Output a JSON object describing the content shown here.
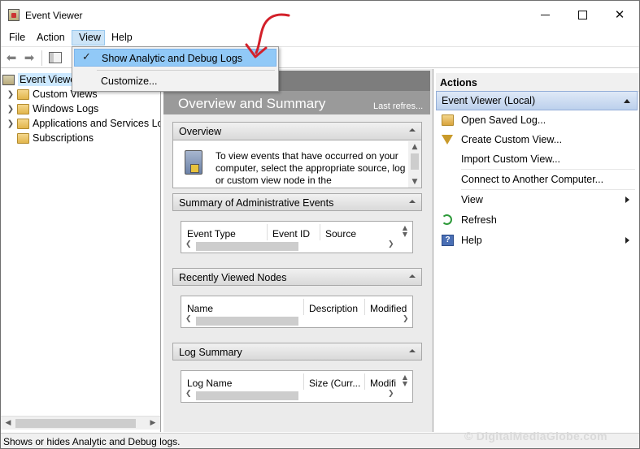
{
  "window": {
    "title": "Event Viewer",
    "minimize_glyph": "",
    "close_glyph": "✕"
  },
  "menubar": {
    "file": "File",
    "action": "Action",
    "view": "View",
    "help": "Help"
  },
  "toolbar": {
    "back_icon": "back-arrow-icon",
    "forward_icon": "forward-arrow-icon",
    "pane_icon": "show-hide-pane-icon"
  },
  "view_menu": {
    "items": [
      {
        "label": "Show Analytic and Debug Logs",
        "checked": true,
        "highlighted": true
      },
      {
        "label": "Customize...",
        "checked": false,
        "highlighted": false
      }
    ]
  },
  "tree": {
    "root": "Event Viewer (Local)",
    "root_visible": "Event Viewe",
    "items": [
      "Custom Views",
      "Windows Logs",
      "Applications and Services Lo",
      "Subscriptions"
    ]
  },
  "center": {
    "header": "Overview and Summary",
    "last_refreshed": "Last refres...",
    "overview": {
      "title": "Overview",
      "text": "To view events that have occurred on your computer, select the appropriate source, log or custom view node in the"
    },
    "admin_events": {
      "title": "Summary of Administrative Events",
      "columns": [
        "Event Type",
        "Event ID",
        "Source"
      ]
    },
    "recent_nodes": {
      "title": "Recently Viewed Nodes",
      "columns": [
        "Name",
        "Description",
        "Modified"
      ]
    },
    "log_summary": {
      "title": "Log Summary",
      "columns": [
        "Log Name",
        "Size (Curr...",
        "Modifi"
      ]
    }
  },
  "actions": {
    "title": "Actions",
    "group": "Event Viewer (Local)",
    "items": [
      {
        "label": "Open Saved Log...",
        "icon": "open-log-icon"
      },
      {
        "label": "Create Custom View...",
        "icon": "filter-icon"
      },
      {
        "label": "Import Custom View...",
        "icon": ""
      },
      {
        "label": "Connect to Another Computer...",
        "icon": ""
      },
      {
        "label": "View",
        "icon": "",
        "submenu": true
      },
      {
        "label": "Refresh",
        "icon": "refresh-icon"
      },
      {
        "label": "Help",
        "icon": "help-icon",
        "submenu": true
      }
    ]
  },
  "statusbar": {
    "text": "Shows or hides Analytic and Debug logs."
  },
  "watermark": "© DigitalMediaGlobe.com",
  "colors": {
    "menu_highlight": "#91c9f7",
    "view_menu_active": "#cce4f7",
    "actions_group": "#bcd0ec",
    "annotation": "#d3202a"
  }
}
